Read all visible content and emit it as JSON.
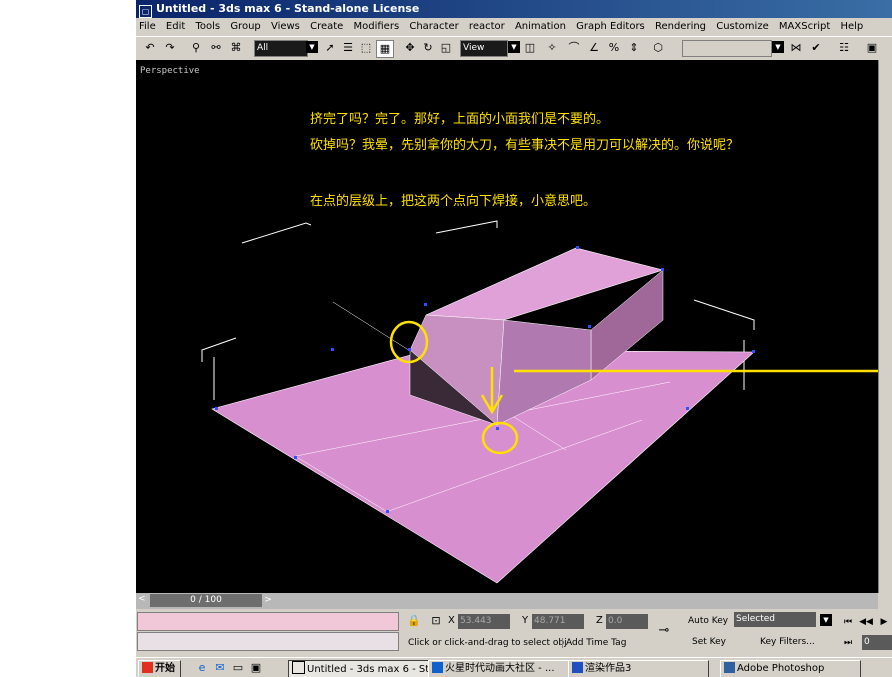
{
  "window": {
    "title": "Untitled - 3ds max 6 - Stand-alone License"
  },
  "menu": [
    "File",
    "Edit",
    "Tools",
    "Group",
    "Views",
    "Create",
    "Modifiers",
    "Character",
    "reactor",
    "Animation",
    "Graph Editors",
    "Rendering",
    "Customize",
    "MAXScript",
    "Help"
  ],
  "toolbar": {
    "selection_filter": "All",
    "coord_system": "View"
  },
  "viewport": {
    "label": "Perspective",
    "annotations": [
      "挤完了吗？完了。那好，上面的小面我们是不要的。",
      "砍掉吗？我晕，先别拿你的大刀，有些事决不是用刀可以解决的。你说呢？",
      "在点的层级上，把这两个点向下焊接，小意思吧。"
    ]
  },
  "timeslider": {
    "frame": "0 / 100",
    "next": ">",
    "prev": "<"
  },
  "status": {
    "x_label": "X",
    "x_value": "53.443",
    "y_label": "Y",
    "y_value": "48.771",
    "z_label": "Z",
    "z_value": "0.0",
    "prompt": "Click or click-and-drag to select obj",
    "add_time_tag": "Add Time Tag",
    "auto_key": "Auto Key",
    "key_mode": "Selected",
    "set_key": "Set Key",
    "key_filters": "Key Filters...",
    "frame_field": "0"
  },
  "taskbar": {
    "start": "开始",
    "tasks": [
      "Untitled - 3ds max 6 - Sta...",
      "火星时代动画大社区 - ...",
      "渲染作品3",
      "Adobe Photoshop"
    ]
  },
  "colors": {
    "mesh": "#d88fd0",
    "annotation": "#ffe000",
    "viewport_bg": "#000000"
  }
}
